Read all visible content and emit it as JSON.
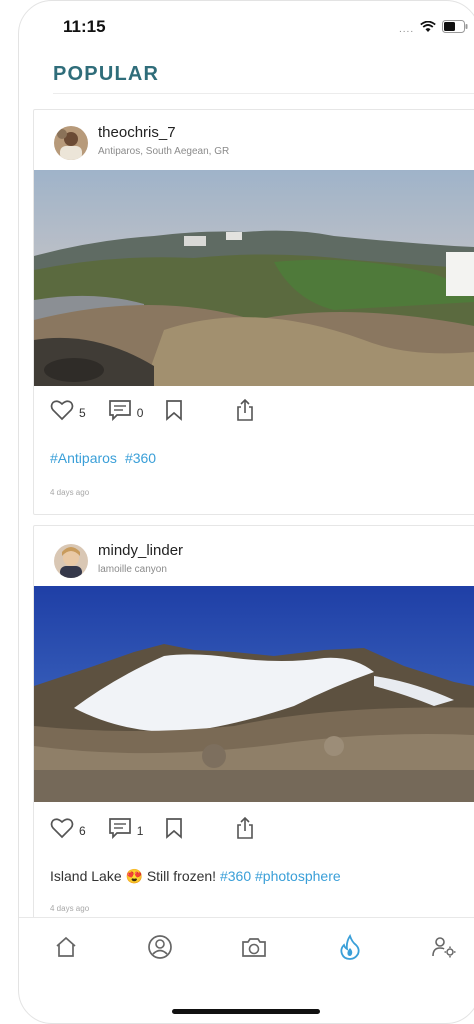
{
  "status_bar": {
    "time": "11:15",
    "signal": "....",
    "icons": [
      "wifi-icon",
      "battery-icon"
    ]
  },
  "page": {
    "title": "POPULAR"
  },
  "posts": [
    {
      "username": "theochris_7",
      "location": "Antiparos, South Aegean, GR",
      "likes": "5",
      "comments": "0",
      "tags": [
        "#Antiparos",
        "#360"
      ],
      "time_ago": "4 days ago"
    },
    {
      "username": "mindy_linder",
      "location": "lamoille canyon",
      "likes": "6",
      "comments": "1",
      "caption_text": "Island Lake",
      "caption_emoji": "😍",
      "caption_rest": "Still frozen!",
      "tags": [
        "#360",
        "#photosphere"
      ],
      "time_ago": "4 days ago"
    }
  ],
  "tabbar": {
    "items": [
      "home-icon",
      "profile-icon",
      "camera-icon",
      "popular-flame-icon",
      "settings-icon"
    ],
    "active": "popular-flame-icon"
  },
  "colors": {
    "accent": "#3a9fd8",
    "title": "#2f6d7a",
    "text": "#222222",
    "muted": "#8b8b8b"
  }
}
